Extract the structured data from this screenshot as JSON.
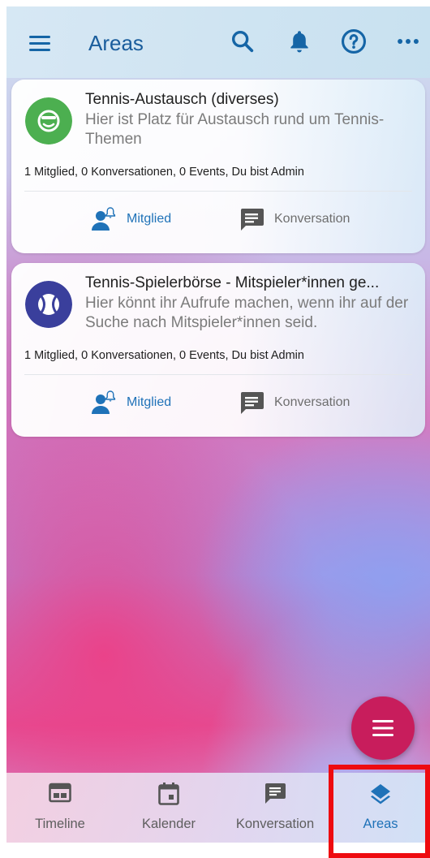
{
  "header": {
    "title": "Areas",
    "icons": [
      "menu-icon",
      "search-icon",
      "bell-icon",
      "help-icon",
      "more-icon"
    ]
  },
  "areas": [
    {
      "title": "Tennis-Austausch (diverses)",
      "description": "Hier ist Platz für Austausch rund um Tennis-Themen",
      "stats": "1 Mitglied, 0 Konversationen, 0 Events, Du bist Admin",
      "member_label": "Mitglied",
      "conversation_label": "Konversation",
      "avatar_color": "#4caf50",
      "avatar_icon": "sunglasses-smiley-icon"
    },
    {
      "title": "Tennis-Spielerbörse - Mitspieler*innen ge...",
      "description": "Hier könnt ihr Aufrufe machen, wenn ihr auf der Suche nach Mitspieler*innen seid.",
      "stats": "1 Mitglied, 0 Konversationen, 0 Events, Du bist Admin",
      "member_label": "Mitglied",
      "conversation_label": "Konversation",
      "avatar_color": "#3a3f9c",
      "avatar_icon": "tennis-ball-icon"
    }
  ],
  "bottom_nav": {
    "items": [
      {
        "label": "Timeline",
        "icon": "timeline-icon"
      },
      {
        "label": "Kalender",
        "icon": "calendar-icon"
      },
      {
        "label": "Konversation",
        "icon": "chat-icon"
      },
      {
        "label": "Areas",
        "icon": "layers-icon",
        "active": true
      }
    ]
  },
  "colors": {
    "accent": "#1f72b8",
    "fab": "#c81d5c",
    "highlight": "#ee0b10"
  }
}
